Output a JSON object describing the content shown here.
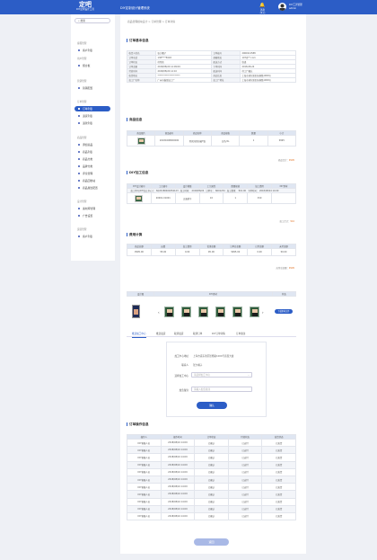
{
  "header": {
    "logo_main": "定吧",
    "logo_sub": "DIY定制设计工具",
    "app_title": "DIY定制设计管理系统",
    "bell_label": "消息(9+)",
    "user_name": "DIY工具管理",
    "user_role": "admin"
  },
  "sidebar": {
    "search_label": "搜索",
    "groups": [
      {
        "label": "客服管理"
      },
      {
        "label": "用户管理"
      },
      {
        "label": "营销管理"
      },
      {
        "label": "订单管理"
      },
      {
        "label": "商品管理"
      },
      {
        "label": "设计管理"
      },
      {
        "label": "运营管理"
      }
    ],
    "items": [
      {
        "label": "客户列表"
      },
      {
        "label": "留言板"
      },
      {
        "label": "营销配置"
      },
      {
        "label": "订单列表"
      },
      {
        "label": "退货列表"
      },
      {
        "label": "退款列表"
      },
      {
        "label": "添加商品"
      },
      {
        "label": "商品列表"
      },
      {
        "label": "商品分类"
      },
      {
        "label": "品牌分类"
      },
      {
        "label": "评论管理"
      },
      {
        "label": "商品回收站"
      },
      {
        "label": "商品属性配置"
      },
      {
        "label": "素材库管理"
      },
      {
        "label": "广告设置"
      },
      {
        "label": "客户列表"
      }
    ]
  },
  "breadcrumb": "商品管理模块设计 > 订单管理 > 订单详情",
  "basic": {
    "title": "订单基本信息",
    "rows": [
      [
        "收货人姓名",
        "张大嘴子",
        "订单编号",
        "2069112588"
      ],
      [
        "订单电话",
        "138****5618",
        "邮箱地址",
        "107@**.com"
      ],
      [
        "订单状态",
        "待付款",
        "配送方式",
        "快递"
      ],
      [
        "订单金额",
        "2018/08/24 14:09:09",
        "下单时间",
        "2018-08-24"
      ],
      [
        "付款时间",
        "2018/08/24 14:10",
        "配送时间",
        "待工厂确认"
      ],
      [
        "收货地址",
        "*********************",
        "商品信息",
        "上海市浦东新区张杨路1000号"
      ],
      [
        "加工厂名称",
        "广州市鑫某加工厂",
        "加工厂地址",
        "上海市浦东新区张杨路1000号"
      ]
    ]
  },
  "products": {
    "title": "商品信息",
    "headers": [
      "商品图片",
      "商品编号",
      "商品名称",
      "商品规格",
      "数量",
      "小计"
    ],
    "rows": [
      [
        "",
        "20180208000000",
        "男款纯色短袖T恤",
        "白色/XL",
        "1",
        "¥995"
      ]
    ],
    "total_label": "商品合计：",
    "total_value": "¥995"
  },
  "diy": {
    "title": "DIY加工信息",
    "headers": [
      "DIY设计编号",
      "工艺编号",
      "设计模版",
      "工艺属性",
      "数量规格",
      "加工费用",
      "DIY素材"
    ],
    "sub": [
      "加工单号(DIY加工中心)",
      "加工时间",
      "订单号",
      "加工费用",
      "下单时间"
    ],
    "sub_vals": [
      "SQ20180402654123",
      "2018/08/24",
      "SR01234",
      "¥10.00",
      "2018/08/24 14:09"
    ],
    "rows": [
      [
        "",
        "20001-01001",
        "正面绣字",
        "10",
        "1",
        "¥10",
        ""
      ]
    ],
    "total_label": "加工合计：",
    "total_value": "¥10"
  },
  "fees": {
    "title": "费用计算",
    "headers": [
      "商品总额",
      "运费",
      "加工费用",
      "优惠金额",
      "订单总金额",
      "已付金额",
      "未付金额"
    ],
    "rows": [
      [
        "¥995.00",
        "¥5.00",
        "0.00",
        "¥0.00",
        "¥995.00",
        "0.00",
        "¥0.00"
      ]
    ],
    "total_label": "应付总金额：",
    "total_value": "¥995"
  },
  "designs": {
    "title": "",
    "headers": [
      "设计图",
      "DIY素材",
      "状态"
    ],
    "status_button": "下载素材文件"
  },
  "tabs": [
    {
      "label": "推送加工中心"
    },
    {
      "label": "推送发货"
    },
    {
      "label": "取消发货"
    },
    {
      "label": "取消订单"
    },
    {
      "label": "DIY订单详情"
    },
    {
      "label": "订单备注"
    }
  ],
  "form": {
    "address_label": "加工中心地址",
    "address_value": "上海市浦东新区张杨路1000号商贸大厦",
    "contact_label": "联系人",
    "contact_value": "张大嘴子",
    "center_label": "选择加工中心",
    "center_placeholder": "请选择加工中心",
    "remark_label": "加急备注",
    "remark_placeholder": "请输入加急备注",
    "submit": "确认"
  },
  "logs": {
    "title": "订单操作信息",
    "headers": [
      "操作人",
      "操作时间",
      "订单状态",
      "付款状态",
      "发货状态"
    ],
    "rows": [
      [
        "DIY客服人员",
        "2018/08/24 14:09",
        "已确认",
        "已支付",
        "已发货"
      ],
      [
        "DIY客服人员",
        "2018/08/24 14:09",
        "已确认",
        "已支付",
        "已发货"
      ],
      [
        "DIY客服人员",
        "2018/08/24 14:09",
        "已确认",
        "已支付",
        "已发货"
      ],
      [
        "DIY客服人员",
        "2018/08/24 14:09",
        "已确认",
        "已支付",
        "已发货"
      ],
      [
        "DIY客服人员",
        "2018/08/24 14:09",
        "已确认",
        "已支付",
        "已发货"
      ],
      [
        "DIY客服人员",
        "2018/08/24 14:09",
        "已确认",
        "已支付",
        "已发货"
      ],
      [
        "DIY客服人员",
        "2018/08/24 14:09",
        "已确认",
        "已支付",
        "已发货"
      ],
      [
        "DIY客服人员",
        "2018/08/24 14:09",
        "已确认",
        "已支付",
        "已发货"
      ],
      [
        "DIY客服人员",
        "2018/08/24 14:09",
        "已确认",
        "已支付",
        "已发货"
      ],
      [
        "DIY客服人员",
        "2018/08/24 14:09",
        "已确认",
        "已支付",
        "已发货"
      ],
      [
        "DIY客服人员",
        "2018/08/24 14:09",
        "已确认",
        "已支付",
        "已发货"
      ]
    ]
  },
  "footer": {
    "back_button": "返回"
  }
}
